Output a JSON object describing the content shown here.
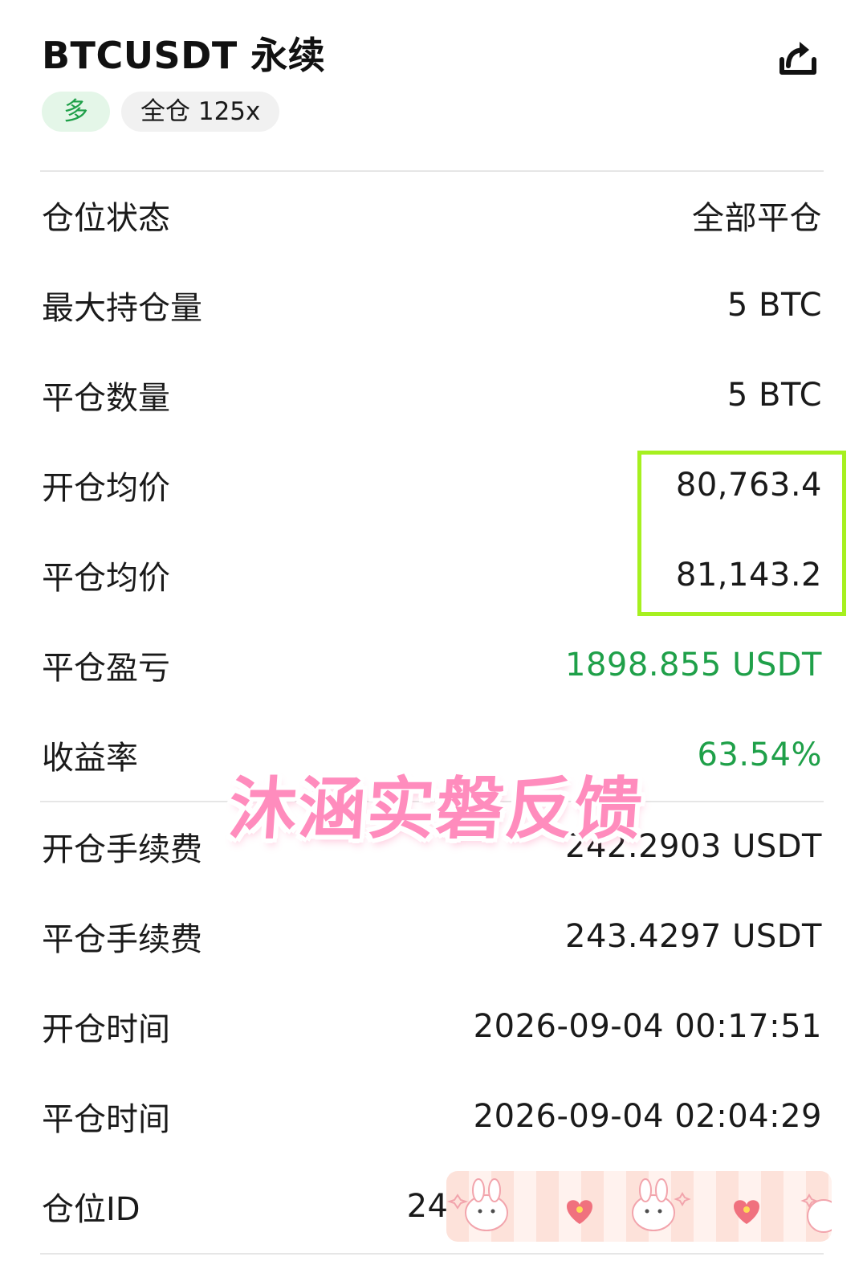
{
  "header": {
    "title": "BTCUSDT 永续",
    "direction_tag": "多",
    "margin_tag": "全仓 125x",
    "share_icon": "share-icon",
    "colors": {
      "long_green": "#1fa049",
      "long_tag_bg": "#e4f6e8",
      "highlight": "#a6f01f",
      "watermark_pink": "#ff8cbd"
    }
  },
  "details": {
    "position_status": {
      "label": "仓位状态",
      "value": "全部平仓"
    },
    "max_position": {
      "label": "最大持仓量",
      "value": "5 BTC"
    },
    "close_quantity": {
      "label": "平仓数量",
      "value": "5 BTC"
    },
    "open_avg_price": {
      "label": "开仓均价",
      "value": "80,763.4"
    },
    "close_avg_price": {
      "label": "平仓均价",
      "value": "81,143.2"
    },
    "realized_pnl": {
      "label": "平仓盈亏",
      "value": "1898.855 USDT"
    },
    "roi": {
      "label": "收益率",
      "value": "63.54%"
    }
  },
  "fees": {
    "open_fee": {
      "label": "开仓手续费",
      "value": "242.2903 USDT"
    },
    "close_fee": {
      "label": "平仓手续费",
      "value": "243.4297 USDT"
    },
    "open_time": {
      "label": "开仓时间",
      "value": "2026-09-04 00:17:51"
    },
    "close_time": {
      "label": "平仓时间",
      "value": "2026-09-04 02:04:29"
    },
    "position_id": {
      "label": "仓位ID",
      "value": "24"
    }
  },
  "overlay": {
    "watermark_text": "沐涵实磐反馈"
  }
}
